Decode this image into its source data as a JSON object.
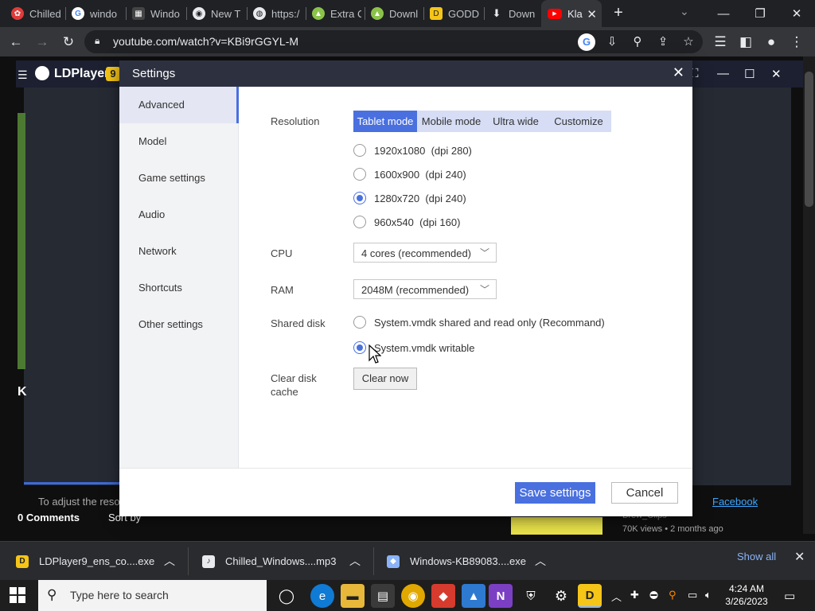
{
  "browser": {
    "tabs": [
      {
        "label": "Chilled",
        "icon": "app-icon"
      },
      {
        "label": "windo",
        "icon": "google-icon"
      },
      {
        "label": "Windo",
        "icon": "game-icon"
      },
      {
        "label": "New T",
        "icon": "chrome-icon"
      },
      {
        "label": "https:/",
        "icon": "globe-icon"
      },
      {
        "label": "Extra C",
        "icon": "android-icon"
      },
      {
        "label": "Downl",
        "icon": "android-icon"
      },
      {
        "label": "GODD",
        "icon": "ldplayer-icon"
      },
      {
        "label": "Down",
        "icon": "download-icon"
      },
      {
        "label": "Kla",
        "icon": "youtube-icon"
      }
    ],
    "url": "youtube.com/watch?v=KBi9rGGYL-M"
  },
  "emulator": {
    "title": "LDPlayer",
    "version_badge": "9"
  },
  "page": {
    "notice": "To adjust the reso",
    "comments": "0 Comments",
    "sort": "Sort by",
    "link": "Facebook",
    "channel": "Brew_Clips",
    "meta": "70K views • 2 months ago",
    "heading_initial": "K"
  },
  "settings": {
    "title": "Settings",
    "sidebar": [
      "Advanced",
      "Model",
      "Game settings",
      "Audio",
      "Network",
      "Shortcuts",
      "Other settings"
    ],
    "resolution_label": "Resolution",
    "modes": [
      "Tablet mode",
      "Mobile mode",
      "Ultra wide",
      "Customize"
    ],
    "resolutions": [
      "1920x1080  (dpi 280)",
      "1600x900  (dpi 240)",
      "1280x720  (dpi 240)",
      "960x540  (dpi 160)"
    ],
    "selected_resolution": 2,
    "cpu_label": "CPU",
    "cpu_value": "4 cores (recommended)",
    "ram_label": "RAM",
    "ram_value": "2048M (recommended)",
    "disk_label": "Shared disk",
    "disk_options": [
      "System.vmdk shared and read only (Recommand)",
      "System.vmdk writable"
    ],
    "selected_disk": 1,
    "clear_label": "Clear disk cache",
    "clear_button": "Clear now",
    "save_button": "Save settings",
    "cancel_button": "Cancel"
  },
  "downloads": {
    "items": [
      "LDPlayer9_ens_co....exe",
      "Chilled_Windows....mp3",
      "Windows-KB89083....exe"
    ],
    "show_all": "Show all"
  },
  "taskbar": {
    "search_placeholder": "Type here to search",
    "time": "4:24 AM",
    "date": "3/26/2023"
  },
  "colors": {
    "accent": "#4a70e0",
    "dialog_header": "#2d313f"
  }
}
